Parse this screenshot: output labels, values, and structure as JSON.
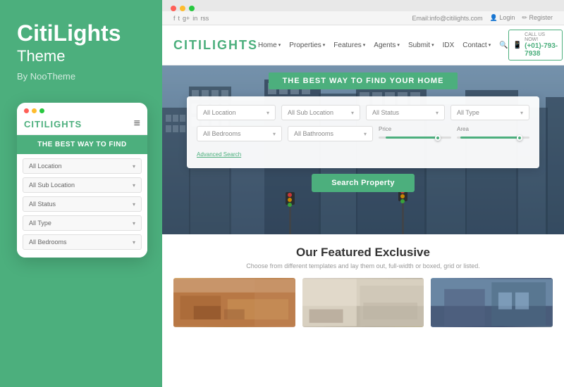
{
  "left": {
    "brand": {
      "title": "CitiLights",
      "sub": "Theme",
      "by": "By NooTheme"
    },
    "mobile": {
      "logo_citi": "CITI",
      "logo_lights": "LIGHTS",
      "hero_text": "THE BEST WAY TO FIND",
      "filters": [
        "All Location",
        "All Sub Location",
        "All Status",
        "All Type",
        "All Bedrooms"
      ]
    }
  },
  "right": {
    "browser_dots": [
      "red",
      "yellow",
      "green"
    ],
    "topbar": {
      "social": "f  t  g+  in  rss",
      "email": "Email:info@citilights.com",
      "login": "Login",
      "register": "Register"
    },
    "nav": {
      "logo_citi": "CITI",
      "logo_lights": "LIGHTS",
      "links": [
        "Home",
        "Properties",
        "Features",
        "Agents",
        "Submit",
        "IDX",
        "Contact"
      ],
      "phone_label": "CALL US NOW!",
      "phone": "(+01)-793-7938"
    },
    "hero": {
      "badge": "THE BEST WAY TO FIND YOUR HOME",
      "filters_row1": [
        "All Location",
        "All Sub Location",
        "All Status",
        "All Type"
      ],
      "filters_row2_left": "All Bedrooms",
      "filters_row2_mid1_label": "Price",
      "filters_row2_mid2_label": "Area",
      "advanced_search": "Advanced Search",
      "search_btn": "Search Property"
    },
    "featured": {
      "title": "Our Featured Exclusive",
      "subtitle": "Choose from different templates and lay them out, full-width or boxed, grid or listed."
    }
  }
}
